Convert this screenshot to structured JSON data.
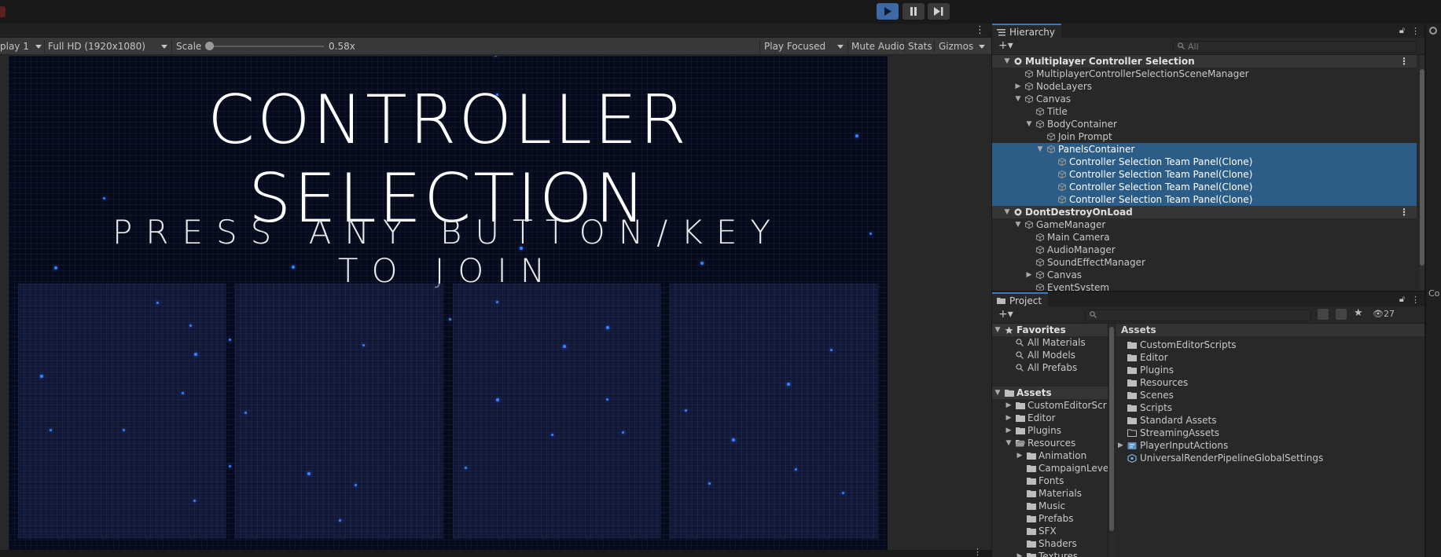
{
  "toolbar": {
    "play": "play-icon",
    "pause": "pause-icon",
    "step": "step-icon",
    "accent": "#3d6aa6"
  },
  "game_view": {
    "display": "play 1",
    "resolution": "Full HD (1920x1080)",
    "scale_label": "Scale",
    "scale_value": "0.58x",
    "scale_fraction": 0.0,
    "play_mode": "Play Focused",
    "mute_audio": "Mute Audio",
    "stats": "Stats",
    "gizmos": "Gizmos",
    "title": "CONTROLLER SELECTION",
    "subtitle_line1": "PRESS ANY BUTTON/KEY",
    "subtitle_line2": "TO JOIN"
  },
  "hierarchy": {
    "tab_label": "Hierarchy",
    "search_placeholder": "All",
    "items": [
      {
        "label": "Multiplayer Controller Selection",
        "depth": 0,
        "type": "scene",
        "expanded": true
      },
      {
        "label": "MultiplayerControllerSelectionSceneManager",
        "depth": 1,
        "expanded": null
      },
      {
        "label": "NodeLayers",
        "depth": 1,
        "expanded": false
      },
      {
        "label": "Canvas",
        "depth": 1,
        "expanded": true
      },
      {
        "label": "Title",
        "depth": 2,
        "expanded": null
      },
      {
        "label": "BodyContainer",
        "depth": 2,
        "expanded": true
      },
      {
        "label": "Join Prompt",
        "depth": 3,
        "expanded": null
      },
      {
        "label": "PanelsContainer",
        "depth": 3,
        "expanded": true,
        "selected": true
      },
      {
        "label": "Controller Selection Team Panel(Clone)",
        "depth": 4,
        "expanded": null,
        "selected": true
      },
      {
        "label": "Controller Selection Team Panel(Clone)",
        "depth": 4,
        "expanded": null,
        "selected": true
      },
      {
        "label": "Controller Selection Team Panel(Clone)",
        "depth": 4,
        "expanded": null,
        "selected": true
      },
      {
        "label": "Controller Selection Team Panel(Clone)",
        "depth": 4,
        "expanded": null,
        "selected": true
      },
      {
        "label": "DontDestroyOnLoad",
        "depth": 0,
        "type": "scene",
        "expanded": true
      },
      {
        "label": "GameManager",
        "depth": 1,
        "expanded": true
      },
      {
        "label": "Main Camera",
        "depth": 2,
        "expanded": null
      },
      {
        "label": "AudioManager",
        "depth": 2,
        "expanded": null
      },
      {
        "label": "SoundEffectManager",
        "depth": 2,
        "expanded": null
      },
      {
        "label": "Canvas",
        "depth": 2,
        "expanded": false
      },
      {
        "label": "EventSystem",
        "depth": 2,
        "expanded": null
      }
    ]
  },
  "project": {
    "tab_label": "Project",
    "hidden_count": "27",
    "tree": [
      {
        "label": "Favorites",
        "depth": 0,
        "kind": "star",
        "header": true
      },
      {
        "label": "All Materials",
        "depth": 1,
        "kind": "search"
      },
      {
        "label": "All Models",
        "depth": 1,
        "kind": "search"
      },
      {
        "label": "All Prefabs",
        "depth": 1,
        "kind": "search"
      },
      {
        "label": "",
        "depth": 0,
        "kind": "spacer"
      },
      {
        "label": "Assets",
        "depth": 0,
        "kind": "folder",
        "header": true,
        "expanded": true
      },
      {
        "label": "CustomEditorScr",
        "depth": 1,
        "kind": "folder",
        "expanded": false
      },
      {
        "label": "Editor",
        "depth": 1,
        "kind": "folder",
        "expanded": false
      },
      {
        "label": "Plugins",
        "depth": 1,
        "kind": "folder",
        "expanded": false
      },
      {
        "label": "Resources",
        "depth": 1,
        "kind": "folder-open",
        "expanded": true
      },
      {
        "label": "Animation",
        "depth": 2,
        "kind": "folder",
        "expanded": false
      },
      {
        "label": "CampaignLeve",
        "depth": 2,
        "kind": "folder"
      },
      {
        "label": "Fonts",
        "depth": 2,
        "kind": "folder"
      },
      {
        "label": "Materials",
        "depth": 2,
        "kind": "folder"
      },
      {
        "label": "Music",
        "depth": 2,
        "kind": "folder"
      },
      {
        "label": "Prefabs",
        "depth": 2,
        "kind": "folder"
      },
      {
        "label": "SFX",
        "depth": 2,
        "kind": "folder"
      },
      {
        "label": "Shaders",
        "depth": 2,
        "kind": "folder"
      },
      {
        "label": "Textures",
        "depth": 2,
        "kind": "folder",
        "expanded": false
      }
    ],
    "assets_header": "Assets",
    "assets": [
      {
        "label": "CustomEditorScripts",
        "kind": "folder"
      },
      {
        "label": "Editor",
        "kind": "folder"
      },
      {
        "label": "Plugins",
        "kind": "folder"
      },
      {
        "label": "Resources",
        "kind": "folder"
      },
      {
        "label": "Scenes",
        "kind": "folder"
      },
      {
        "label": "Scripts",
        "kind": "folder"
      },
      {
        "label": "Standard Assets",
        "kind": "folder"
      },
      {
        "label": "StreamingAssets",
        "kind": "folder-empty"
      },
      {
        "label": "PlayerInputActions",
        "kind": "input-actions",
        "expandable": true
      },
      {
        "label": "UniversalRenderPipelineGlobalSettings",
        "kind": "settings"
      }
    ]
  },
  "right_strip": {
    "cutoff_text": "Co"
  }
}
